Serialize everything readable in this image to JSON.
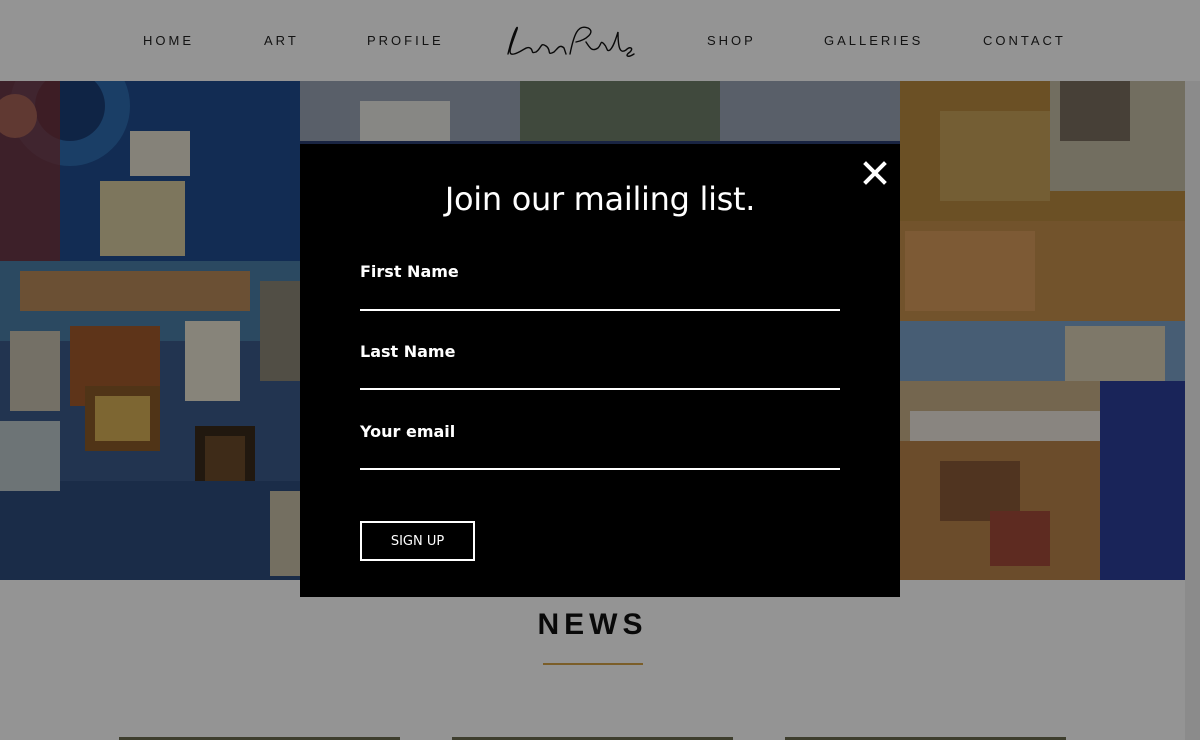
{
  "nav": {
    "left": [
      "HOME",
      "ART",
      "PROFILE"
    ],
    "right": [
      "SHOP",
      "GALLERIES",
      "CONTACT"
    ],
    "logo_text": "Leon Pericles"
  },
  "news": {
    "title": "NEWS"
  },
  "modal": {
    "title": "Join our mailing list.",
    "fields": [
      {
        "label": "First Name",
        "value": ""
      },
      {
        "label": "Last Name",
        "value": ""
      },
      {
        "label": "Your email",
        "value": ""
      }
    ],
    "button_label": "SIGN UP"
  },
  "colors": {
    "accent_gold": "#d4a248",
    "modal_bg": "#000000",
    "overlay": "rgba(0,0,0,0.42)"
  },
  "icons": {
    "close": "close-icon",
    "logo": "signature-logo"
  }
}
